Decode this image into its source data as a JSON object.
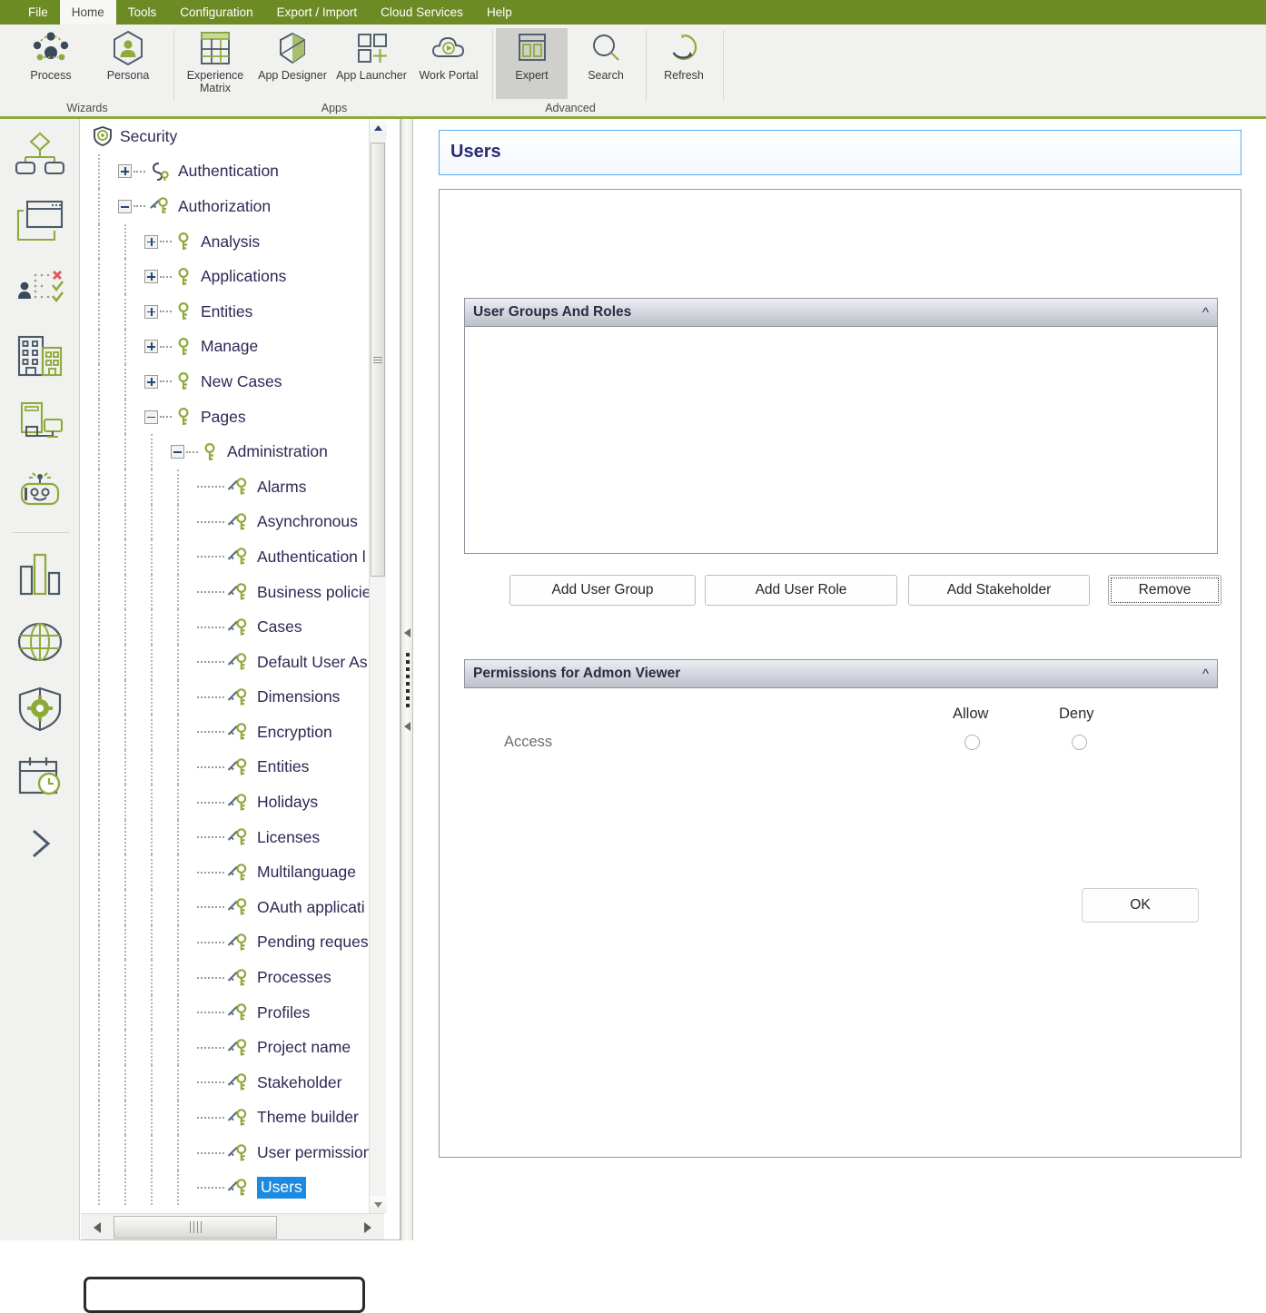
{
  "ribbon": {
    "tabs": [
      {
        "label": "File",
        "active": false
      },
      {
        "label": "Home",
        "active": true
      },
      {
        "label": "Tools",
        "active": false
      },
      {
        "label": "Configuration",
        "active": false
      },
      {
        "label": "Export / Import",
        "active": false
      },
      {
        "label": "Cloud Services",
        "active": false
      },
      {
        "label": "Help",
        "active": false
      }
    ],
    "groups": [
      {
        "name": "Wizards",
        "label": "Wizards",
        "items": [
          {
            "label": "Process",
            "icon": "process-nodes-icon"
          },
          {
            "label": "Persona",
            "icon": "persona-hexagon-icon"
          }
        ]
      },
      {
        "name": "Apps",
        "label": "Apps",
        "items": [
          {
            "label": "Experience Matrix",
            "icon": "experience-matrix-icon"
          },
          {
            "label": "App Designer",
            "icon": "app-designer-hexagon-icon"
          },
          {
            "label": "App Launcher",
            "icon": "app-launcher-squares-icon"
          },
          {
            "label": "Work Portal",
            "icon": "work-portal-cloud-icon"
          }
        ]
      },
      {
        "name": "Advanced",
        "label": "Advanced",
        "items": [
          {
            "label": "Expert",
            "icon": "expert-layout-icon",
            "selected": true
          },
          {
            "label": "Search",
            "icon": "search-magnifier-icon"
          }
        ]
      },
      {
        "name": "Refresh",
        "label": "",
        "items": [
          {
            "label": "Refresh",
            "icon": "refresh-circular-arrow-icon"
          }
        ]
      }
    ]
  },
  "rail": {
    "icons": [
      {
        "name": "process-diagram-icon"
      },
      {
        "name": "forms-window-icon"
      },
      {
        "name": "user-assignment-icon"
      },
      {
        "name": "organization-buildings-icon"
      },
      {
        "name": "devices-icon"
      },
      {
        "name": "bot-robot-icon"
      },
      {
        "name": "analytics-bars-icon"
      },
      {
        "name": "globe-integration-icon"
      },
      {
        "name": "security-shield-gear-icon"
      },
      {
        "name": "calendar-clock-icon"
      },
      {
        "name": "expand-chevron-right-icon"
      }
    ]
  },
  "tree": {
    "nodes": [
      {
        "label": "Security",
        "depth": 0,
        "toggle": "none",
        "icon": "security-shield-icon"
      },
      {
        "label": "Authentication",
        "depth": 1,
        "toggle": "plus",
        "icon": "authentication-icon"
      },
      {
        "label": "Authorization",
        "depth": 1,
        "toggle": "minus",
        "icon": "authorization-key-icon"
      },
      {
        "label": "Analysis",
        "depth": 2,
        "toggle": "plus",
        "icon": "key-icon"
      },
      {
        "label": "Applications",
        "depth": 2,
        "toggle": "plus",
        "icon": "key-icon"
      },
      {
        "label": "Entities",
        "depth": 2,
        "toggle": "plus",
        "icon": "key-icon"
      },
      {
        "label": "Manage",
        "depth": 2,
        "toggle": "plus",
        "icon": "key-icon"
      },
      {
        "label": "New Cases",
        "depth": 2,
        "toggle": "plus",
        "icon": "key-icon"
      },
      {
        "label": "Pages",
        "depth": 2,
        "toggle": "minus",
        "icon": "key-icon"
      },
      {
        "label": "Administration",
        "depth": 3,
        "toggle": "minus",
        "icon": "key-icon"
      },
      {
        "label": "Alarms",
        "depth": 4,
        "toggle": "leaf",
        "icon": "double-key-icon"
      },
      {
        "label": "Asynchronous",
        "depth": 4,
        "toggle": "leaf",
        "icon": "double-key-icon"
      },
      {
        "label": "Authentication l",
        "depth": 4,
        "toggle": "leaf",
        "icon": "double-key-icon"
      },
      {
        "label": "Business policie",
        "depth": 4,
        "toggle": "leaf",
        "icon": "double-key-icon"
      },
      {
        "label": "Cases",
        "depth": 4,
        "toggle": "leaf",
        "icon": "double-key-icon"
      },
      {
        "label": "Default User As",
        "depth": 4,
        "toggle": "leaf",
        "icon": "double-key-icon"
      },
      {
        "label": "Dimensions",
        "depth": 4,
        "toggle": "leaf",
        "icon": "double-key-icon"
      },
      {
        "label": "Encryption",
        "depth": 4,
        "toggle": "leaf",
        "icon": "double-key-icon"
      },
      {
        "label": "Entities",
        "depth": 4,
        "toggle": "leaf",
        "icon": "double-key-icon"
      },
      {
        "label": "Holidays",
        "depth": 4,
        "toggle": "leaf",
        "icon": "double-key-icon"
      },
      {
        "label": "Licenses",
        "depth": 4,
        "toggle": "leaf",
        "icon": "double-key-icon"
      },
      {
        "label": "Multilanguage",
        "depth": 4,
        "toggle": "leaf",
        "icon": "double-key-icon"
      },
      {
        "label": "OAuth applicati",
        "depth": 4,
        "toggle": "leaf",
        "icon": "double-key-icon"
      },
      {
        "label": "Pending reques",
        "depth": 4,
        "toggle": "leaf",
        "icon": "double-key-icon"
      },
      {
        "label": "Processes",
        "depth": 4,
        "toggle": "leaf",
        "icon": "double-key-icon"
      },
      {
        "label": "Profiles",
        "depth": 4,
        "toggle": "leaf",
        "icon": "double-key-icon"
      },
      {
        "label": "Project name",
        "depth": 4,
        "toggle": "leaf",
        "icon": "double-key-icon"
      },
      {
        "label": "Stakeholder",
        "depth": 4,
        "toggle": "leaf",
        "icon": "double-key-icon"
      },
      {
        "label": "Theme builder",
        "depth": 4,
        "toggle": "leaf",
        "icon": "double-key-icon"
      },
      {
        "label": "User permission",
        "depth": 4,
        "toggle": "leaf",
        "icon": "double-key-icon"
      },
      {
        "label": "Users",
        "depth": 4,
        "toggle": "leaf",
        "icon": "double-key-icon",
        "selected": true
      }
    ],
    "selected_label": "Users"
  },
  "page": {
    "title": "Users",
    "sections": [
      {
        "name": "user-groups-and-roles",
        "title": "User Groups And Roles",
        "collapse_icon": "chevron-up-double-icon",
        "list_items": []
      },
      {
        "name": "permissions",
        "title": "Permissions for Admon Viewer",
        "collapse_icon": "chevron-up-double-icon"
      }
    ],
    "buttons": {
      "add_user_group": "Add User Group",
      "add_user_role": "Add User Role",
      "add_stakeholder": "Add Stakeholder",
      "remove": "Remove",
      "ok": "OK"
    },
    "permissions": {
      "column_allow": "Allow",
      "column_deny": "Deny",
      "rows": [
        {
          "label": "Access",
          "allow": false,
          "deny": false
        }
      ]
    }
  },
  "colors": {
    "brand_green": "#6d8b24",
    "accent_green": "#8faa3c",
    "selection_blue": "#1b8ae0",
    "header_blue_border": "#5aaef0",
    "title_navy": "#2a2a78",
    "tree_text": "#2a2a55",
    "section_grey": "#bcc0ca"
  }
}
